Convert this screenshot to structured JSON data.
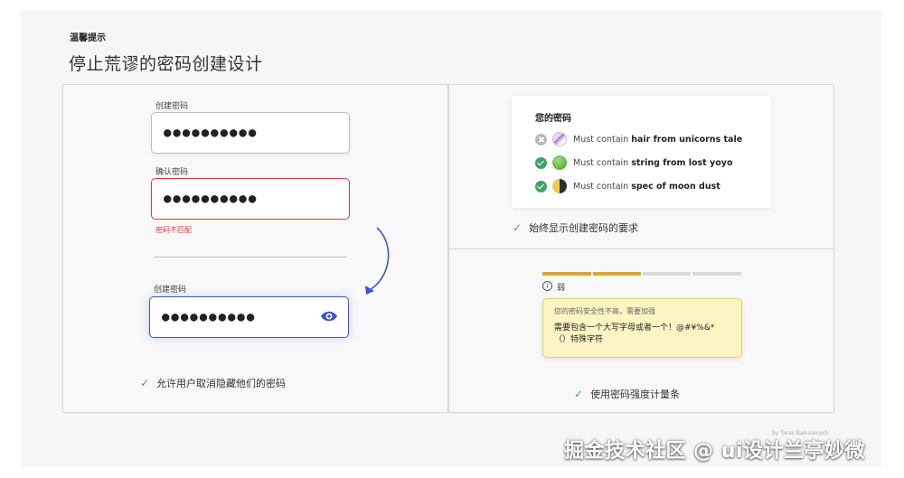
{
  "header": {
    "eyebrow": "温馨提示",
    "title": "停止荒谬的密码创建设计"
  },
  "left_panel": {
    "create_label": "创建密码",
    "create_value": "●●●●●●●●●●",
    "confirm_label": "确认密码",
    "confirm_value": "●●●●●●●●●●",
    "mismatch_error": "密码不匹配",
    "create_label_2": "创建密码",
    "create_value_2": "●●●●●●●●●●",
    "eye_icon": "eye-icon",
    "caption": "允许用户取消隐藏他们的密码"
  },
  "right_top": {
    "card_title": "您的密码",
    "requirements": [
      {
        "status": "unmet",
        "icon": "unicorn-icon",
        "prefix": "Must contain",
        "bold": "hair from unicorns tale"
      },
      {
        "status": "met",
        "icon": "yoyo-icon",
        "prefix": "Must contain",
        "bold": "string from lost yoyo"
      },
      {
        "status": "met",
        "icon": "moon-icon",
        "prefix": "Must contain",
        "bold": "spec of moon dust"
      }
    ],
    "caption": "始终显示创建密码的要求"
  },
  "right_bottom": {
    "strength_level": 0.5,
    "strength_label": "弱",
    "tooltip_head": "您的密码安全性不高，需要加强",
    "tooltip_body": "需要包含一个大写字母或者一个！@#¥%&*（）特殊字符",
    "caption": "使用密码强度计量条"
  },
  "colors": {
    "error": "#d43b3b",
    "focus": "#3e56c7",
    "check": "#3ea36a",
    "strength": "#d7a53c",
    "tooltip_bg": "#fdf4c4"
  },
  "footer": {
    "credit": "by Taras Bakusevych",
    "watermark": "掘金技术社区 @ ui设计兰亭妙微"
  }
}
